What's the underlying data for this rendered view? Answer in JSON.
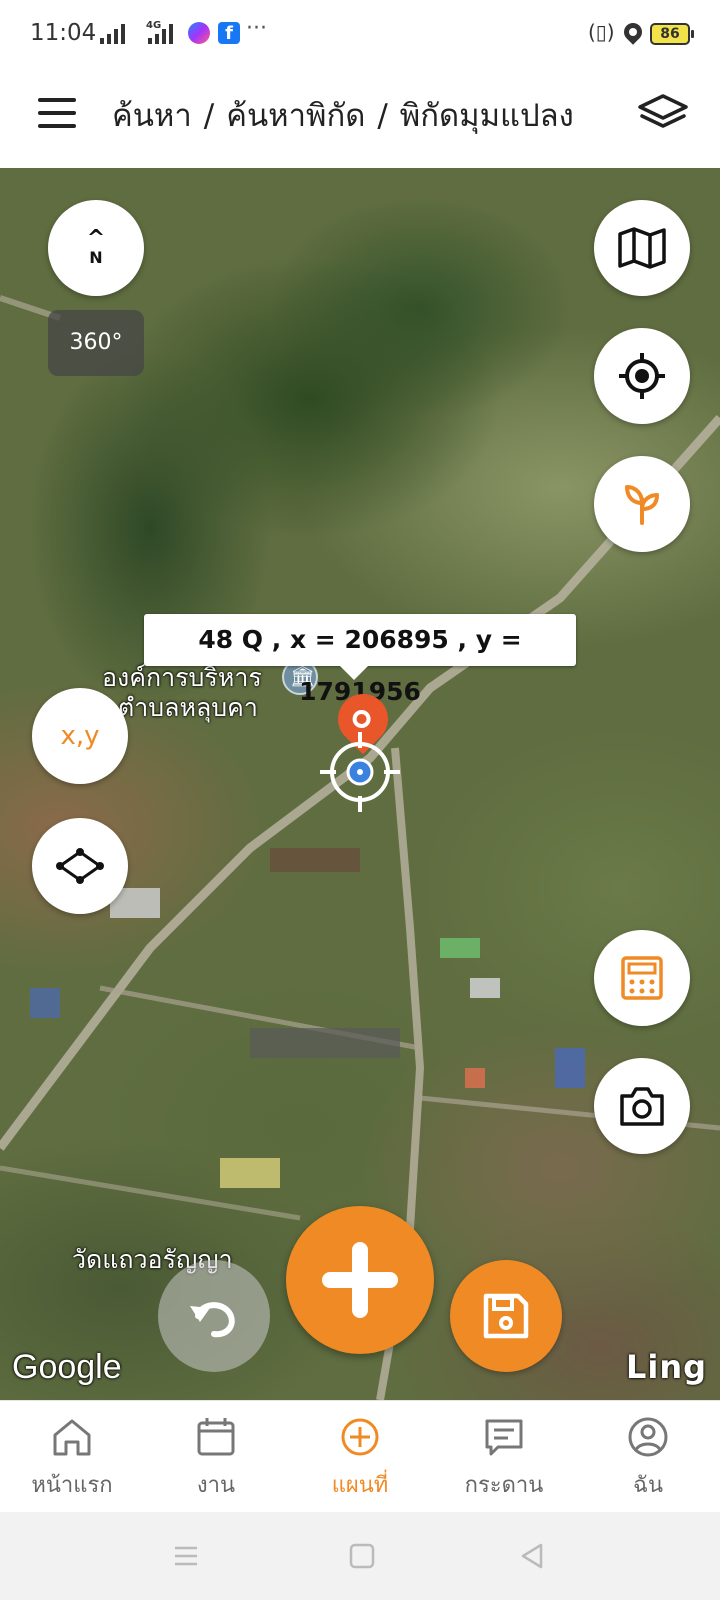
{
  "status_bar": {
    "time": "11:04",
    "network": "4G",
    "more": "···",
    "battery": "86",
    "icons": [
      "signal-icon",
      "messenger-icon",
      "facebook-icon",
      "vibrate-icon",
      "location-icon",
      "battery-icon"
    ]
  },
  "header": {
    "breadcrumb": [
      "ค้นหา",
      "ค้นหาพิกัด",
      "พิกัดมุมแปลง"
    ],
    "separator": "/",
    "menu_icon": "hamburger-menu-icon",
    "layers_icon": "layers-icon"
  },
  "map": {
    "compass_arrow": "^",
    "compass_label": "N",
    "view_360": "360°",
    "coordinate_label": "48 Q , x = 206895 , y = 1791956",
    "place_labels": {
      "org_line1": "องค์การบริหาร",
      "org_line2": "ตำบลหลุบคา",
      "temple": "วัดแถวอรัญญา"
    },
    "xy_button": "x,y",
    "google_attribution": "Google",
    "provider_label": "Ling",
    "accent_color": "#F08A24"
  },
  "bottom_nav": {
    "items": [
      {
        "label": "หน้าแรก",
        "icon": "home-icon"
      },
      {
        "label": "งาน",
        "icon": "calendar-icon"
      },
      {
        "label": "แผนที่",
        "icon": "plus-circle-icon",
        "active": true
      },
      {
        "label": "กระดาน",
        "icon": "board-icon"
      },
      {
        "label": "ฉัน",
        "icon": "user-icon"
      }
    ]
  }
}
